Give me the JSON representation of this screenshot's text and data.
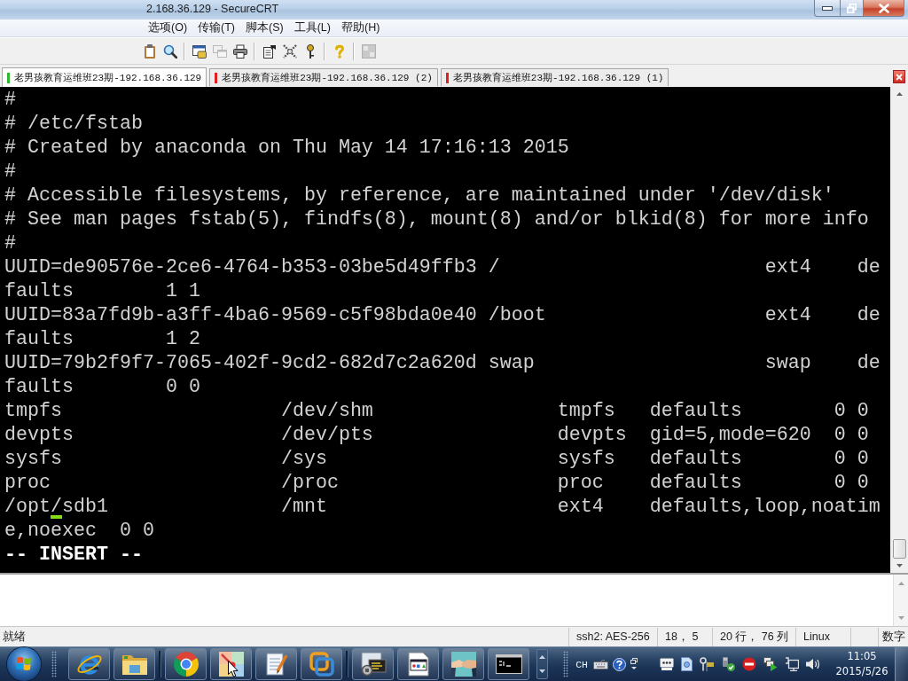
{
  "window": {
    "title": "2.168.36.129 - SecureCRT"
  },
  "menu": [
    "选项(O)",
    "传输(T)",
    "脚本(S)",
    "工具(L)",
    "帮助(H)"
  ],
  "toolbar": [
    {
      "disabled": false
    },
    {
      "disabled": false
    },
    {
      "disabled": false
    },
    {
      "disabled": true
    },
    {
      "disabled": false
    },
    {
      "disabled": false
    },
    {
      "disabled": false
    },
    {
      "disabled": false
    },
    {
      "disabled": false
    },
    {
      "disabled": true
    }
  ],
  "tabs": [
    {
      "label": "老男孩教育运维班23期-192.168.36.129",
      "selected": true,
      "color": "#2eb82e"
    },
    {
      "label": "老男孩教育运维班23期-192.168.36.129 (2)",
      "selected": false,
      "color": "#e02020"
    },
    {
      "label": "老男孩教育运维班23期-192.168.36.129 (1)",
      "selected": false,
      "color": "#e02020"
    }
  ],
  "terminal": {
    "lines": [
      {
        "text": "#",
        "bold": false
      },
      {
        "text": "# /etc/fstab",
        "bold": false
      },
      {
        "text": "# Created by anaconda on Thu May 14 17:16:13 2015",
        "bold": false
      },
      {
        "text": "#",
        "bold": false
      },
      {
        "text": "# Accessible filesystems, by reference, are maintained under '/dev/disk'",
        "bold": false
      },
      {
        "text": "# See man pages fstab(5), findfs(8), mount(8) and/or blkid(8) for more info",
        "bold": false
      },
      {
        "text": "#",
        "bold": false
      },
      {
        "text": "UUID=de90576e-2ce6-4764-b353-03be5d49ffb3 /                       ext4    de",
        "bold": false
      },
      {
        "text": "faults        1 1",
        "bold": false
      },
      {
        "text": "UUID=83a7fd9b-a3ff-4ba6-9569-c5f98bda0e40 /boot                   ext4    de",
        "bold": false
      },
      {
        "text": "faults        1 2",
        "bold": false
      },
      {
        "text": "UUID=79b2f9f7-7065-402f-9cd2-682d7c2a620d swap                    swap    de",
        "bold": false
      },
      {
        "text": "faults        0 0",
        "bold": false
      },
      {
        "text": "tmpfs                   /dev/shm                tmpfs   defaults        0 0",
        "bold": false
      },
      {
        "text": "devpts                  /dev/pts                devpts  gid=5,mode=620  0 0",
        "bold": false
      },
      {
        "text": "sysfs                   /sys                    sysfs   defaults        0 0",
        "bold": false
      },
      {
        "text": "proc                    /proc                   proc    defaults        0 0",
        "bold": false
      },
      {
        "segments": [
          {
            "text": "/opt",
            "cursor": false
          },
          {
            "text": "/",
            "cursor": true
          },
          {
            "text": "sdb1               /mnt                    ext4    defaults,loop,noatim",
            "cursor": false
          }
        ],
        "bold": false
      },
      {
        "text": "e,noexec  0 0",
        "bold": false
      },
      {
        "text": "-- INSERT --",
        "bold": true
      }
    ]
  },
  "status_bar": {
    "message": "就绪",
    "panes": [
      "ssh2: AES-256",
      "18， 5",
      "20 行， 76 列",
      "Linux",
      "数字"
    ]
  },
  "taskbar": {
    "input_language": "CH",
    "time": "11:05",
    "date": "2015/5/26"
  }
}
